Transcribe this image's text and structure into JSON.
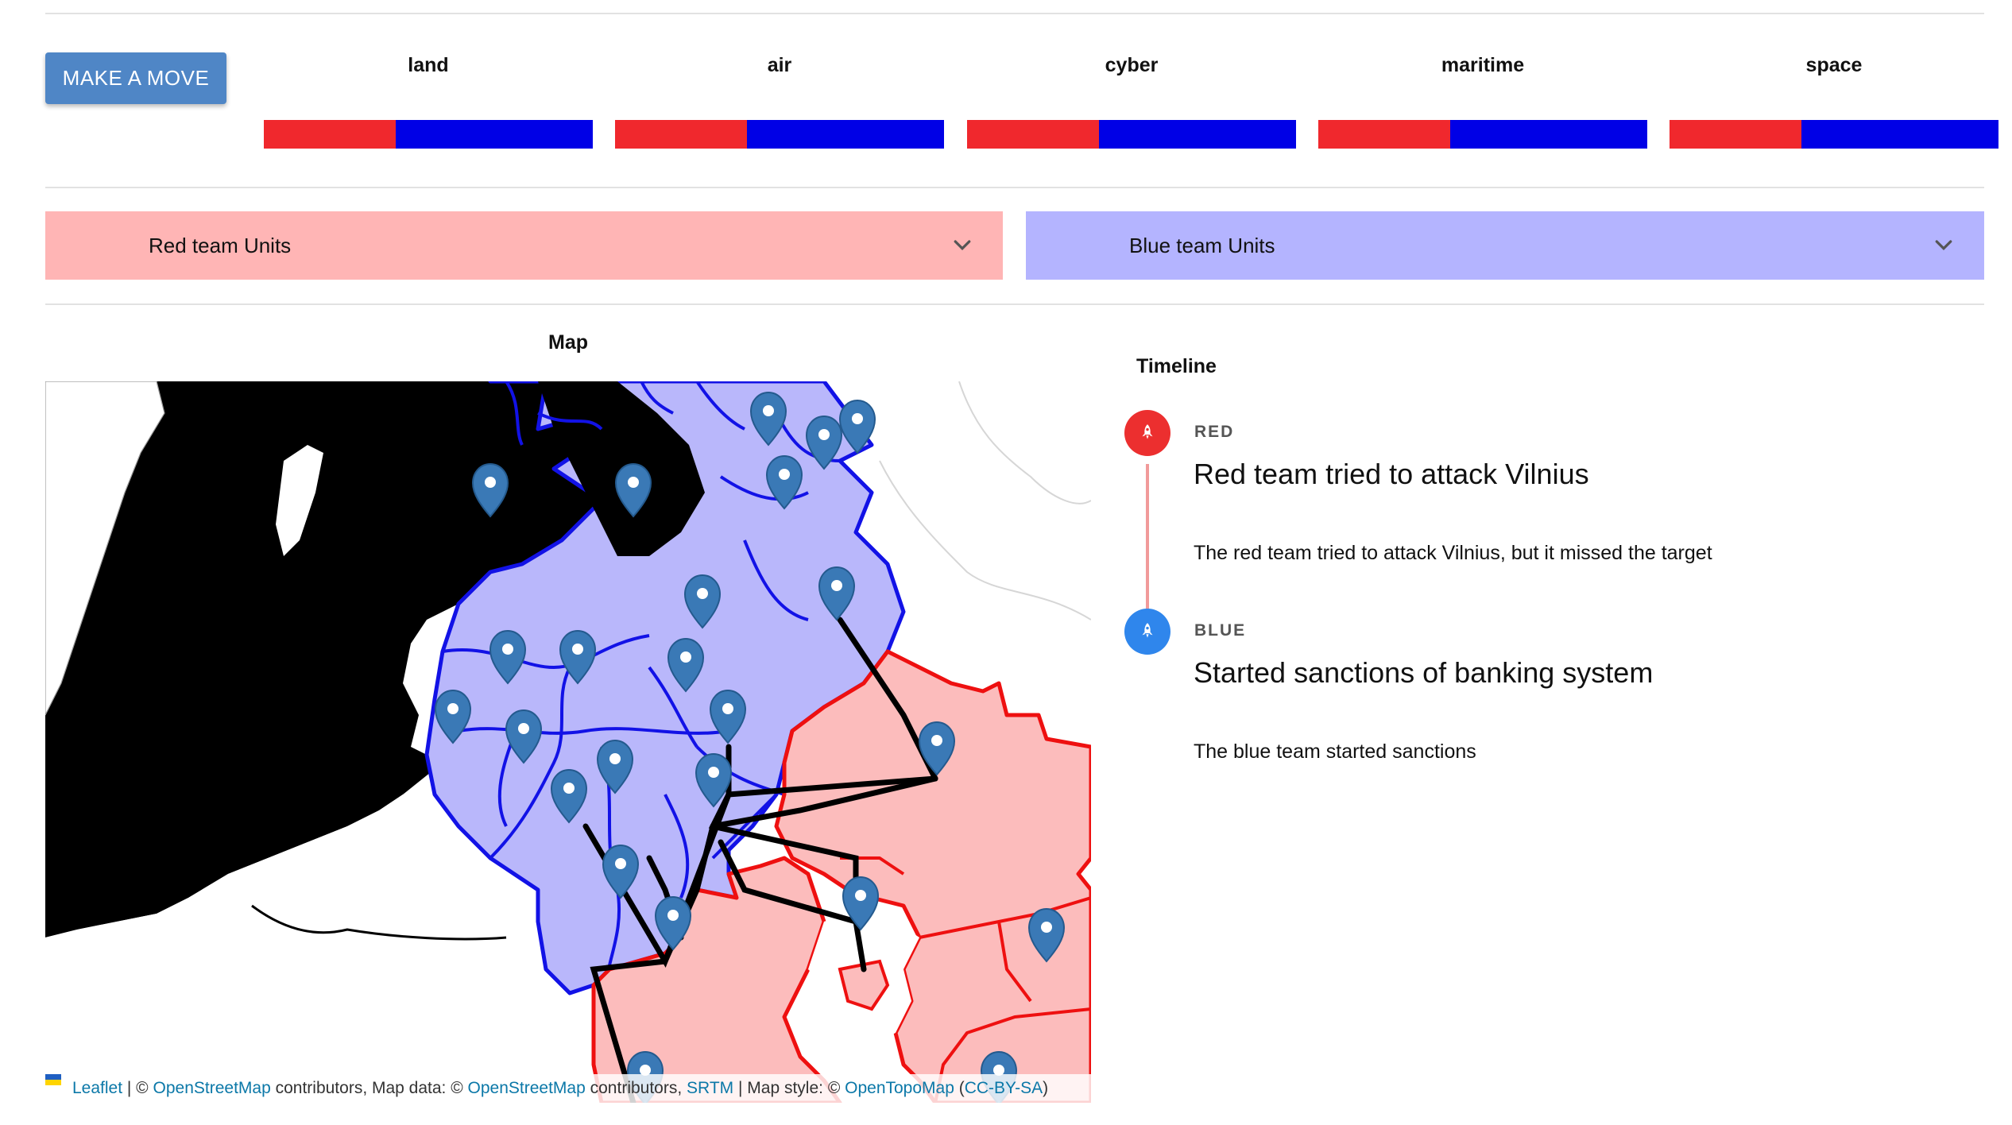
{
  "toolbar": {
    "make_move_label": "MAKE A MOVE"
  },
  "domains": [
    {
      "label": "land",
      "red_share": 0.4
    },
    {
      "label": "air",
      "red_share": 0.4
    },
    {
      "label": "cyber",
      "red_share": 0.4
    },
    {
      "label": "maritime",
      "red_share": 0.4
    },
    {
      "label": "space",
      "red_share": 0.4
    }
  ],
  "colors": {
    "red_bar": "#f0282d",
    "blue_bar": "#0000e6",
    "red_accordion_bg": "#ffb5b5",
    "blue_accordion_bg": "#b4b4ff",
    "red_timeline": "#ec2f2f",
    "blue_timeline": "#2f86ec"
  },
  "units": {
    "red_label": "Red team Units",
    "blue_label": "Blue team Units"
  },
  "map": {
    "title": "Map",
    "attribution": {
      "leaflet": "Leaflet",
      "sep1": " | © ",
      "osm1": "OpenStreetMap",
      "mid1": " contributors, Map data: © ",
      "osm2": "OpenStreetMap",
      "mid2": " contributors, ",
      "srtm": "SRTM",
      "mid3": " | Map style: © ",
      "otm": "OpenTopoMap",
      "paren_open": " (",
      "license": "CC-BY-SA",
      "paren_close": ")"
    }
  },
  "timeline": {
    "title": "Timeline",
    "events": [
      {
        "team": "RED",
        "heading": "Red team tried to attack Vilnius",
        "description": "The red team tried to attack Vilnius, but it missed the target",
        "icon": "rocket-icon"
      },
      {
        "team": "BLUE",
        "heading": "Started sanctions of banking system",
        "description": "The blue team started sanctions",
        "icon": "rocket-icon"
      }
    ]
  }
}
